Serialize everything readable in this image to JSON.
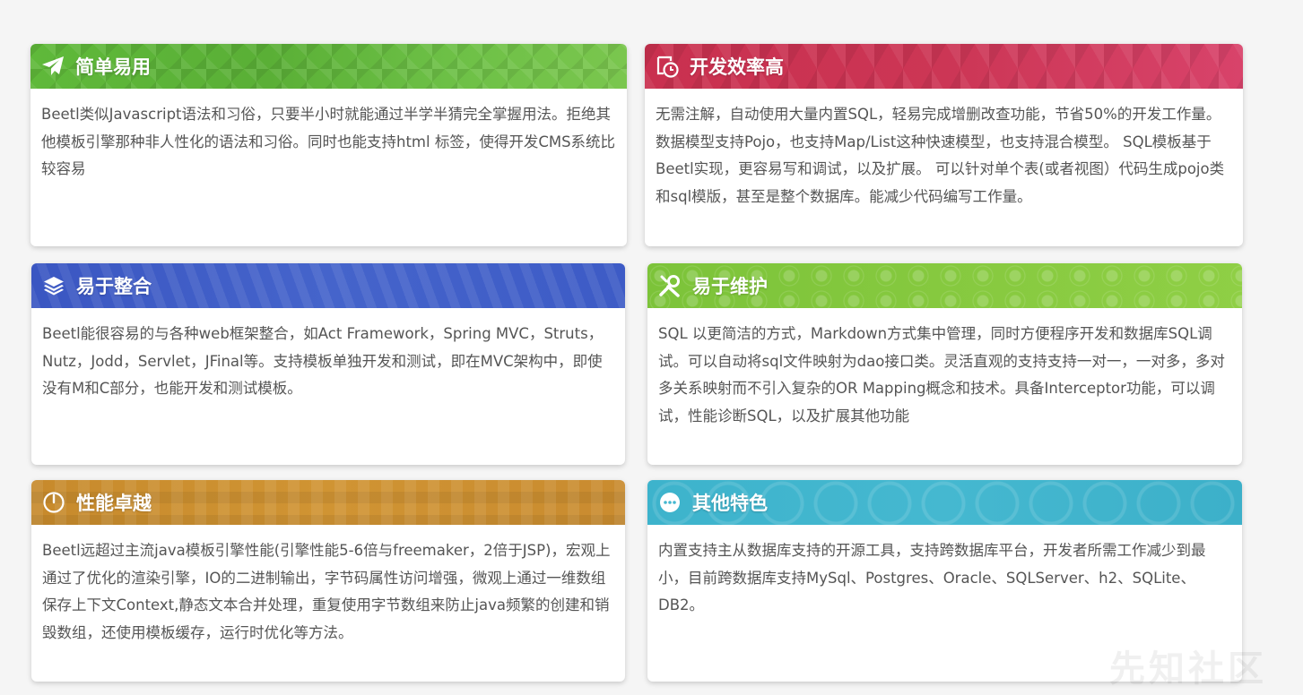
{
  "cards": [
    {
      "title": "简单易用",
      "icon": "paper-plane-icon",
      "color": "#5fb93a",
      "text": "Beetl类似Javascript语法和习俗，只要半小时就能通过半学半猜完全掌握用法。拒绝其他模板引擎那种非人性化的语法和习俗。同时也能支持html 标签，使得开发CMS系统比较容易"
    },
    {
      "title": "开发效率高",
      "icon": "clock-icon",
      "color": "#cc3655",
      "text": "无需注解，自动使用大量内置SQL，轻易完成增删改查功能，节省50%的开发工作量。 数据模型支持Pojo，也支持Map/List这种快速模型，也支持混合模型。 SQL模板基于Beetl实现，更容易写和调试，以及扩展。 可以针对单个表(或者视图）代码生成pojo类和sql模版，甚至是整个数据库。能减少代码编写工作量。"
    },
    {
      "title": "易于整合",
      "icon": "layers-icon",
      "color": "#4564cb",
      "text": "Beetl能很容易的与各种web框架整合，如Act Framework，Spring MVC，Struts，Nutz，Jodd，Servlet，JFinal等。支持模板单独开发和测试，即在MVC架构中，即使没有M和C部分，也能开发和测试模板。"
    },
    {
      "title": "易于维护",
      "icon": "wrench-screwdriver-icon",
      "color": "#86c93f",
      "text": "SQL 以更简洁的方式，Markdown方式集中管理，同时方便程序开发和数据库SQL调试。可以自动将sql文件映射为dao接口类。灵活直观的支持支持一对一，一对多，多对多关系映射而不引入复杂的OR Mapping概念和技术。具备Interceptor功能，可以调试，性能诊断SQL，以及扩展其他功能"
    },
    {
      "title": "性能卓越",
      "icon": "speedometer-icon",
      "color": "#d09433",
      "text": "Beetl远超过主流java模板引擎性能(引擎性能5-6倍与freemaker，2倍于JSP)，宏观上通过了优化的渲染引擎，IO的二进制输出，字节码属性访问增强，微观上通过一维数组保存上下文Context,静态文本合并处理，重复使用字节数组来防止java频繁的创建和销毁数组，还使用模板缓存，运行时优化等方法。"
    },
    {
      "title": "其他特色",
      "icon": "chat-bubble-icon",
      "color": "#45b8d0",
      "text": "内置支持主从数据库支持的开源工具，支持跨数据库平台，开发者所需工作减少到最小，目前跨数据库支持MySql、Postgres、Oracle、SQLServer、h2、SQLite、DB2。"
    }
  ],
  "watermark": "先知社区"
}
